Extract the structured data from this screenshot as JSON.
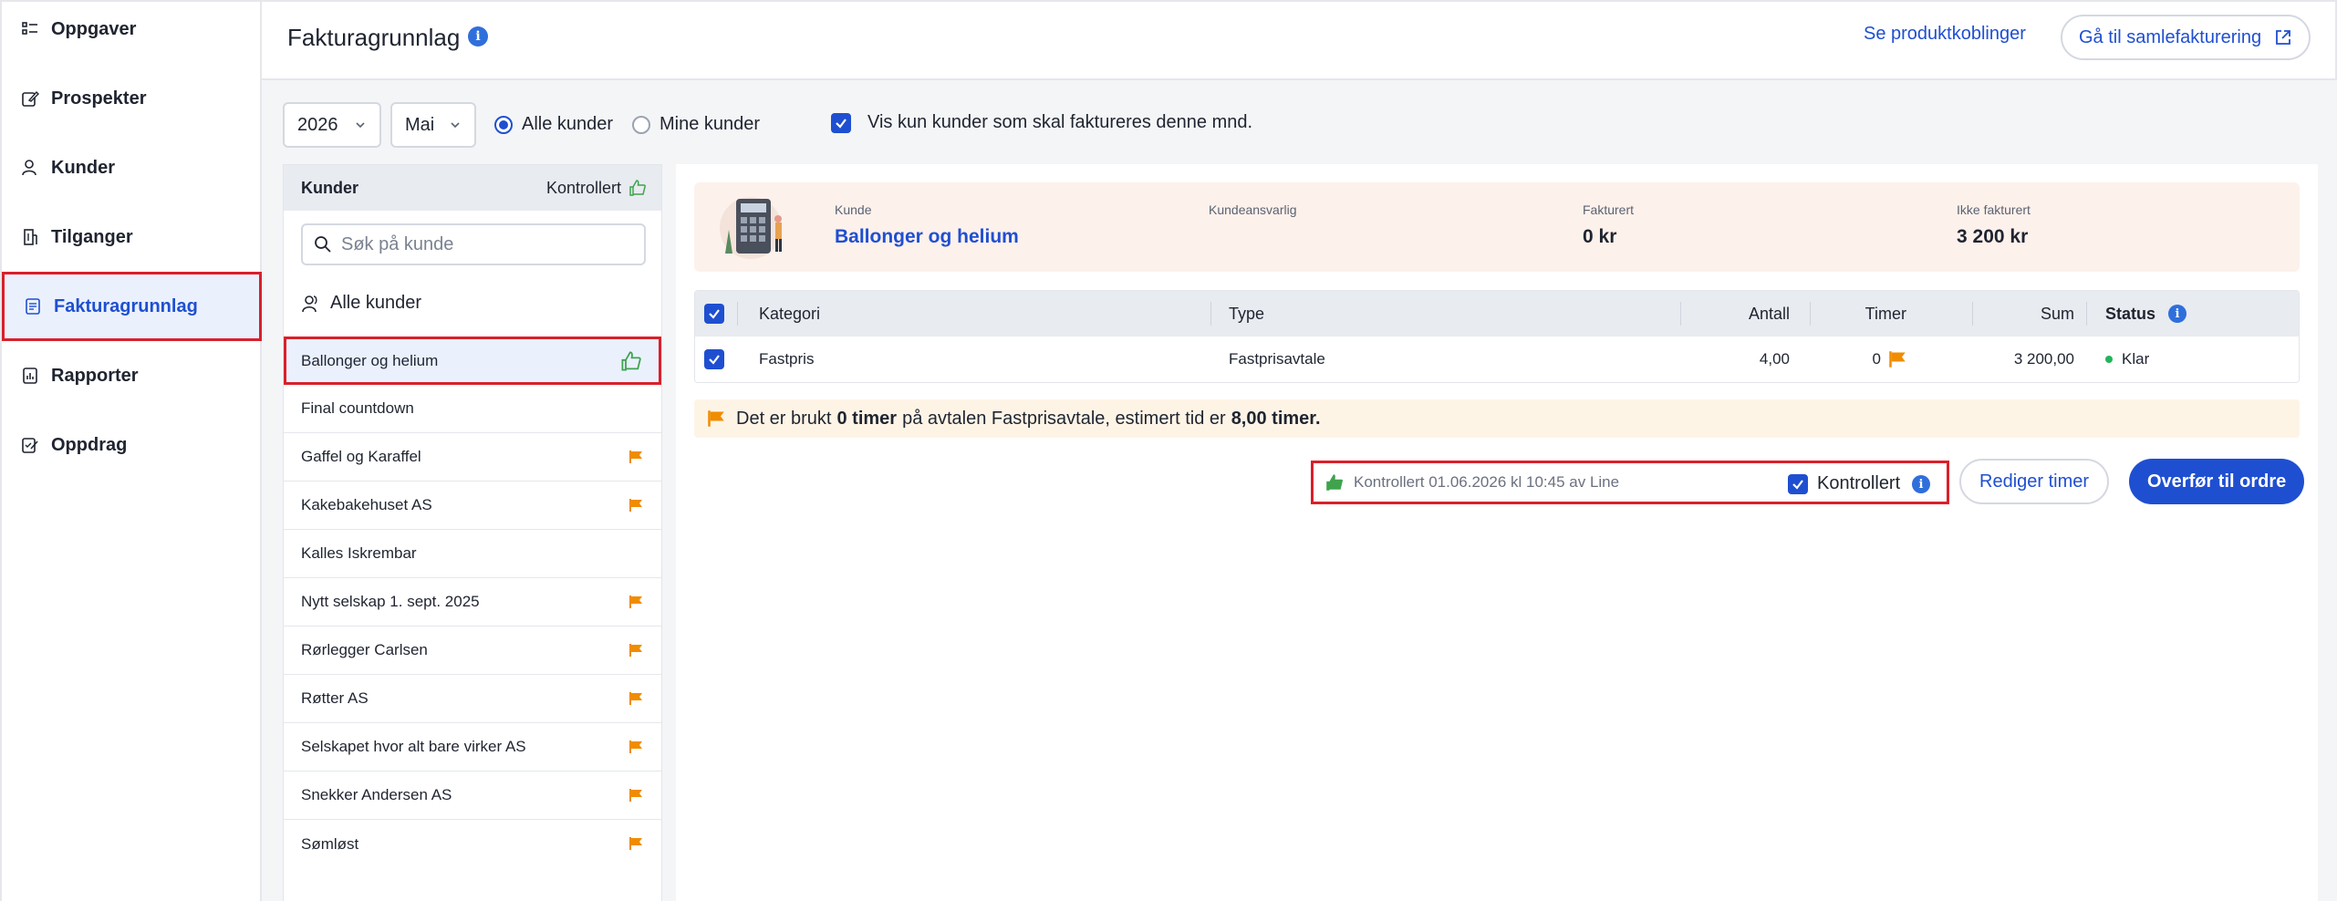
{
  "sidebar": {
    "items": [
      {
        "label": "Oppgaver",
        "icon": "task-list-icon"
      },
      {
        "label": "Prospekter",
        "icon": "prospect-edit-icon"
      },
      {
        "label": "Kunder",
        "icon": "user-icon"
      },
      {
        "label": "Tilganger",
        "icon": "building-icon"
      },
      {
        "label": "Fakturagrunnlag",
        "icon": "document-icon",
        "active": true
      },
      {
        "label": "Rapporter",
        "icon": "report-icon"
      },
      {
        "label": "Oppdrag",
        "icon": "assignment-icon"
      }
    ]
  },
  "header": {
    "title": "Fakturagrunnlag",
    "product_links": "Se produktkoblinger",
    "bulk_invoice": "Gå til samlefakturering"
  },
  "filters": {
    "year": "2026",
    "month": "Mai",
    "radio_all": "Alle kunder",
    "radio_mine": "Mine kunder",
    "only_invoice_label": "Vis kun kunder som skal faktureres denne mnd."
  },
  "customer_list": {
    "header_title": "Kunder",
    "header_controlled": "Kontrollert",
    "search_placeholder": "Søk på kunde",
    "all_customers": "Alle kunder",
    "rows": [
      {
        "name": "Ballonger og helium",
        "marker": "thumb"
      },
      {
        "name": "Final countdown",
        "marker": "none"
      },
      {
        "name": "Gaffel og Karaffel",
        "marker": "flag"
      },
      {
        "name": "Kakebakehuset AS",
        "marker": "flag"
      },
      {
        "name": "Kalles Iskrembar",
        "marker": "none"
      },
      {
        "name": "Nytt selskap 1. sept. 2025",
        "marker": "flag"
      },
      {
        "name": "Rørlegger Carlsen",
        "marker": "flag"
      },
      {
        "name": "Røtter AS",
        "marker": "flag"
      },
      {
        "name": "Selskapet hvor alt bare virker AS",
        "marker": "flag"
      },
      {
        "name": "Snekker Andersen AS",
        "marker": "flag"
      },
      {
        "name": "Sømløst",
        "marker": "flag"
      }
    ]
  },
  "summary": {
    "customer_label": "Kunde",
    "customer_value": "Ballonger og helium",
    "responsible_label": "Kundeansvarlig",
    "invoiced_label": "Fakturert",
    "invoiced_value": "0 kr",
    "not_invoiced_label": "Ikke fakturert",
    "not_invoiced_value": "3 200 kr"
  },
  "table": {
    "headers": {
      "category": "Kategori",
      "type": "Type",
      "count": "Antall",
      "hours": "Timer",
      "sum": "Sum",
      "status": "Status"
    },
    "rows": [
      {
        "category": "Fastpris",
        "type": "Fastprisavtale",
        "count": "4,00",
        "hours": "0",
        "sum": "3 200,00",
        "status": "Klar"
      }
    ]
  },
  "notice": {
    "part1": "Det er brukt",
    "hours_used": "0 timer",
    "part2": "på avtalen Fastprisavtale, estimert tid er",
    "estimated": "8,00 timer."
  },
  "control": {
    "text": "Kontrollert 01.06.2026 kl 10:45 av Line",
    "checkbox_label": "Kontrollert"
  },
  "actions": {
    "edit_hours": "Rediger timer",
    "transfer": "Overfør til ordre"
  },
  "colors": {
    "accent": "#1f4fd1",
    "highlight": "#d9202b",
    "flag": "#f08c00",
    "thumb": "#3fa34d",
    "status_ok": "#22b55b"
  }
}
